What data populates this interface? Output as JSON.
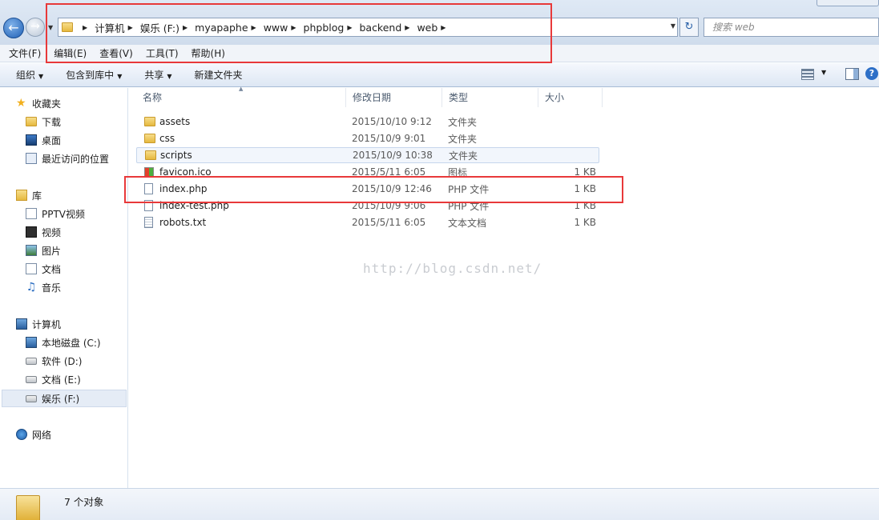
{
  "address": {
    "crumbs": [
      "计算机",
      "娱乐 (F:)",
      "myapaphe",
      "www",
      "phpblog",
      "backend",
      "web"
    ],
    "search_placeholder": "搜索 web"
  },
  "menu": [
    "文件(F)",
    "编辑(E)",
    "查看(V)",
    "工具(T)",
    "帮助(H)"
  ],
  "commands": [
    {
      "label": "组织",
      "dropdown": true
    },
    {
      "label": "包含到库中",
      "dropdown": true
    },
    {
      "label": "共享",
      "dropdown": true
    },
    {
      "label": "新建文件夹",
      "dropdown": false
    }
  ],
  "sidebar": {
    "favorites": {
      "label": "收藏夹",
      "items": [
        "下载",
        "桌面",
        "最近访问的位置"
      ]
    },
    "libraries": {
      "label": "库",
      "items": [
        "PPTV视频",
        "视频",
        "图片",
        "文档",
        "音乐"
      ]
    },
    "computer": {
      "label": "计算机",
      "items": [
        "本地磁盘 (C:)",
        "软件 (D:)",
        "文档 (E:)",
        "娱乐 (F:)"
      ],
      "selected": "娱乐 (F:)"
    },
    "network": {
      "label": "网络"
    }
  },
  "columns": [
    "名称",
    "修改日期",
    "类型",
    "大小"
  ],
  "files": [
    {
      "name": "assets",
      "date": "2015/10/10 9:12",
      "type": "文件夹",
      "size": "",
      "kind": "folder"
    },
    {
      "name": "css",
      "date": "2015/10/9 9:01",
      "type": "文件夹",
      "size": "",
      "kind": "folder"
    },
    {
      "name": "scripts",
      "date": "2015/10/9 10:38",
      "type": "文件夹",
      "size": "",
      "kind": "folder"
    },
    {
      "name": "favicon.ico",
      "date": "2015/5/11 6:05",
      "type": "图标",
      "size": "1 KB",
      "kind": "ico"
    },
    {
      "name": "index.php",
      "date": "2015/10/9 12:46",
      "type": "PHP 文件",
      "size": "1 KB",
      "kind": "php"
    },
    {
      "name": "index-test.php",
      "date": "2015/10/9 9:06",
      "type": "PHP 文件",
      "size": "1 KB",
      "kind": "php"
    },
    {
      "name": "robots.txt",
      "date": "2015/5/11 6:05",
      "type": "文本文档",
      "size": "1 KB",
      "kind": "txt"
    }
  ],
  "watermark": "http://blog.csdn.net/",
  "status": {
    "count": "7 个对象"
  }
}
